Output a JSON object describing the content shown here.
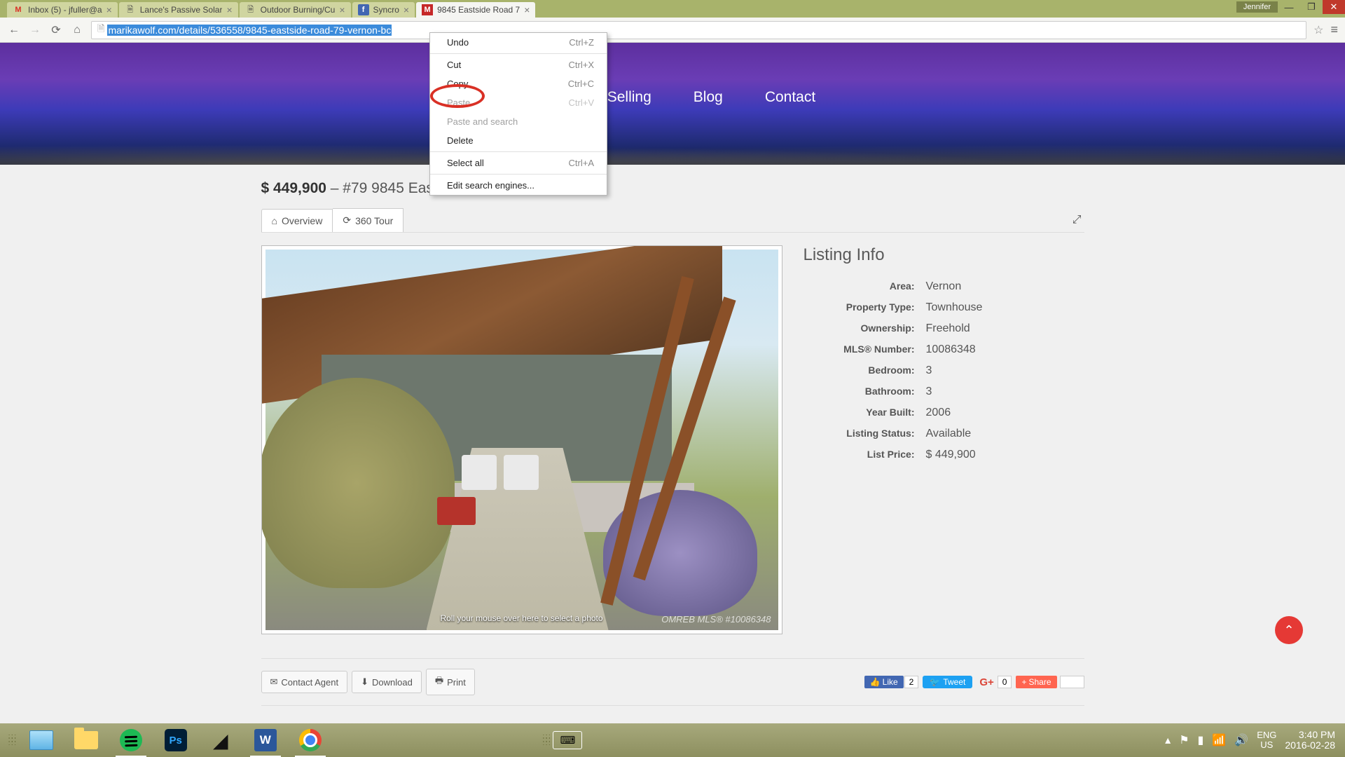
{
  "browser": {
    "tabs": [
      {
        "title": "Inbox (5) - jfuller@a",
        "icon_letter": "M",
        "icon_color": "#d93025"
      },
      {
        "title": "Lance's Passive Solar",
        "icon_letter": "📄",
        "icon_color": "#888"
      },
      {
        "title": "Outdoor Burning/Cu",
        "icon_letter": "📄",
        "icon_color": "#888"
      },
      {
        "title": "Syncro",
        "icon_letter": "f",
        "icon_color": "#4267b2"
      },
      {
        "title": "9845 Eastside Road 7",
        "icon_letter": "M",
        "icon_color": "#c62828"
      }
    ],
    "active_tab": 4,
    "user": "Jennifer",
    "url": "marikawolf.com/details/536558/9845-eastside-road-79-vernon-bc"
  },
  "context_menu": {
    "items": [
      {
        "label": "Undo",
        "shortcut": "Ctrl+Z",
        "disabled": false
      },
      {
        "sep": true
      },
      {
        "label": "Cut",
        "shortcut": "Ctrl+X",
        "disabled": false
      },
      {
        "label": "Copy",
        "shortcut": "Ctrl+C",
        "disabled": false
      },
      {
        "label": "Paste",
        "shortcut": "Ctrl+V",
        "disabled": true
      },
      {
        "label": "Paste and search",
        "shortcut": "",
        "disabled": true
      },
      {
        "label": "Delete",
        "shortcut": "",
        "disabled": false
      },
      {
        "sep": true
      },
      {
        "label": "Select all",
        "shortcut": "Ctrl+A",
        "disabled": false
      },
      {
        "sep": true
      },
      {
        "label": "Edit search engines...",
        "shortcut": "",
        "disabled": false
      }
    ]
  },
  "nav": {
    "item1": "Buying and Selling",
    "item2": "Blog",
    "item3": "Contact"
  },
  "listing": {
    "price": "$ 449,900",
    "subtitle": "– #79 9845 Eas",
    "tab_overview": "Overview",
    "tab_360": "360 Tour",
    "info_title": "Listing Info",
    "fields": {
      "area": {
        "label": "Area:",
        "value": "Vernon"
      },
      "type": {
        "label": "Property Type:",
        "value": "Townhouse"
      },
      "ownership": {
        "label": "Ownership:",
        "value": "Freehold"
      },
      "mls": {
        "label": "MLS® Number:",
        "value": "10086348"
      },
      "bedroom": {
        "label": "Bedroom:",
        "value": "3"
      },
      "bathroom": {
        "label": "Bathroom:",
        "value": "3"
      },
      "year": {
        "label": "Year Built:",
        "value": "2006"
      },
      "status": {
        "label": "Listing Status:",
        "value": "Available"
      },
      "listprice": {
        "label": "List Price:",
        "value": "$ 449,900"
      }
    },
    "photo_caption": "Roll your mouse over here to select a photo",
    "photo_watermark": "OMREB MLS® #10086348"
  },
  "actions": {
    "contact": "Contact Agent",
    "download": "Download",
    "print": "Print",
    "fb_like": "Like",
    "fb_count": "2",
    "tweet": "Tweet",
    "gplus_count": "0",
    "share": "Share"
  },
  "taskbar": {
    "lang1": "ENG",
    "lang2": "US",
    "time": "3:40 PM",
    "date": "2016-02-28"
  }
}
